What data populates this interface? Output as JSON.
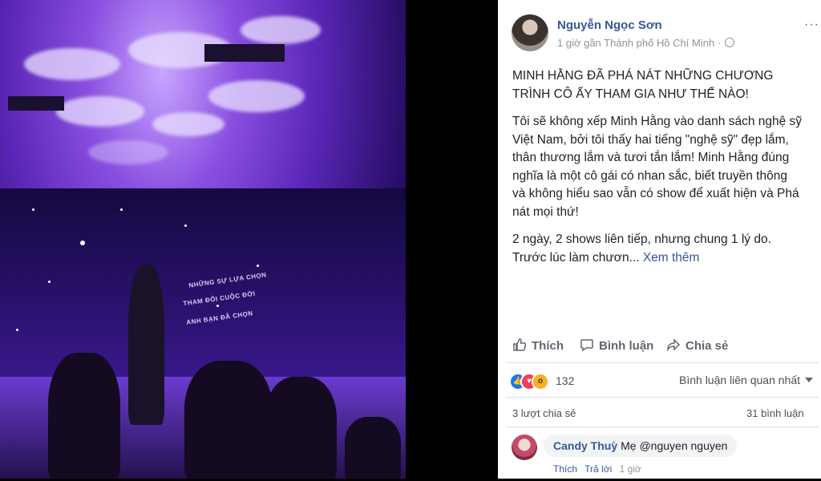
{
  "post": {
    "author": "Nguyễn Ngọc Sơn",
    "time_location": "1 giờ gần Thành phố Hồ Chí Minh",
    "separator": "·",
    "more_label": "···",
    "paragraphs": [
      "MINH HẰNG ĐÃ PHÁ NÁT NHỮNG CHƯƠNG TRÌNH CÔ ẤY THAM GIA NHƯ THẾ NÀO!",
      "Tôi sẽ không xếp Minh Hằng vào danh sách nghệ sỹ Việt Nam, bởi tôi thấy hai tiếng \"nghệ sỹ\" đẹp lắm, thân thương lắm và tươi tắn lắm! Minh Hằng đúng nghĩa là một cô gái có nhan sắc, biết truyền thông và không hiểu sao vẫn có show để xuất hiện và Phá nát mọi thứ!"
    ],
    "last_paragraph": "2 ngày, 2 shows liên tiếp, nhưng chung 1 lý do. Trước lúc làm chươn...",
    "see_more": "Xem thêm"
  },
  "actions": {
    "like": "Thích",
    "comment": "Bình luận",
    "share": "Chia sẻ"
  },
  "stats": {
    "reaction_count": "132",
    "sort_label": "Bình luận liên quan nhất",
    "shares": "3 lượt chia sẻ",
    "comments": "31 bình luận"
  },
  "comment": {
    "name": "Candy Thuỳ",
    "text": "Mẹ @nguyen nguyen",
    "like": "Thích",
    "reply": "Trả lời",
    "time": "1 giờ"
  },
  "colors": {
    "link": "#365899",
    "text": "#1d2129",
    "muted": "#90949c",
    "like_reaction": "#1877f2",
    "love_reaction": "#f33e58",
    "wow_reaction": "#f7b125"
  }
}
